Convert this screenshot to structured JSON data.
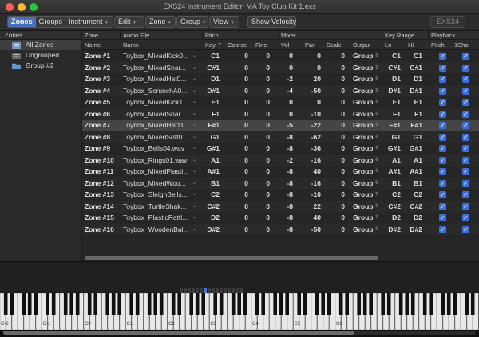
{
  "window": {
    "title": "EXS24 Instrument Editor: MA Toy Club Kit 1.exs"
  },
  "toolbar": {
    "view_toggle": [
      "Zones",
      "Groups"
    ],
    "menus": [
      "Instrument",
      "Edit",
      "Zone",
      "Group",
      "View"
    ],
    "show_velocity_label": "Show Velocity",
    "exs24_label": "EXS24"
  },
  "sidebar": {
    "header": "Zones",
    "items": [
      {
        "label": "All Zones",
        "icon": "all-zones-icon",
        "selected": true
      },
      {
        "label": "Ungrouped",
        "icon": "ungrouped-icon",
        "selected": false
      },
      {
        "label": "Group #2",
        "icon": "folder-icon",
        "selected": false
      }
    ]
  },
  "table": {
    "group_headers": [
      "Zone",
      "Audio File",
      "Pitch",
      "Mixer",
      "Key Range",
      "Playback"
    ],
    "columns": [
      "Name",
      "Name",
      "Key",
      "Coarse",
      "Fine",
      "Vol",
      "Pan",
      "Scale",
      "Output",
      "Lo",
      "Hi",
      "Pitch",
      "1Sho"
    ],
    "rows": [
      {
        "zone": "Zone #1",
        "file": "Toybox_MixedKick0...",
        "key": "C1",
        "coarse": "0",
        "fine": "0",
        "vol": "0",
        "pan": "0",
        "scale": "0",
        "output": "Group",
        "lo": "C1",
        "hi": "C1",
        "pitch": true,
        "oneshot": true
      },
      {
        "zone": "Zone #2",
        "file": "Toybox_MixedSnar...",
        "key": "C#1",
        "coarse": "0",
        "fine": "0",
        "vol": "0",
        "pan": "0",
        "scale": "0",
        "output": "Group",
        "lo": "C#1",
        "hi": "C#1",
        "pitch": true,
        "oneshot": true
      },
      {
        "zone": "Zone #3",
        "file": "Toybox_MixedHat0...",
        "key": "D1",
        "coarse": "0",
        "fine": "0",
        "vol": "-2",
        "pan": "20",
        "scale": "0",
        "output": "Group",
        "lo": "D1",
        "hi": "D1",
        "pitch": true,
        "oneshot": true
      },
      {
        "zone": "Zone #4",
        "file": "Toybox_ScrunchA0...",
        "key": "D#1",
        "coarse": "0",
        "fine": "0",
        "vol": "-4",
        "pan": "-50",
        "scale": "0",
        "output": "Group",
        "lo": "D#1",
        "hi": "D#1",
        "pitch": true,
        "oneshot": true
      },
      {
        "zone": "Zone #5",
        "file": "Toybox_MixedKick1...",
        "key": "E1",
        "coarse": "0",
        "fine": "0",
        "vol": "0",
        "pan": "0",
        "scale": "0",
        "output": "Group",
        "lo": "E1",
        "hi": "E1",
        "pitch": true,
        "oneshot": true
      },
      {
        "zone": "Zone #6",
        "file": "Toybox_MixedSnar...",
        "key": "F1",
        "coarse": "0",
        "fine": "0",
        "vol": "0",
        "pan": "-10",
        "scale": "0",
        "output": "Group",
        "lo": "F1",
        "hi": "F1",
        "pitch": true,
        "oneshot": true
      },
      {
        "zone": "Zone #7",
        "file": "Toybox_MixedHat11...",
        "key": "F#1",
        "coarse": "0",
        "fine": "0",
        "vol": "-5",
        "pan": "-22",
        "scale": "0",
        "output": "Group",
        "lo": "F#1",
        "hi": "F#1",
        "pitch": true,
        "oneshot": true,
        "selected": true
      },
      {
        "zone": "Zone #8",
        "file": "Toybox_MixedSoft0...",
        "key": "G1",
        "coarse": "0",
        "fine": "0",
        "vol": "-8",
        "pan": "-62",
        "scale": "0",
        "output": "Group",
        "lo": "G1",
        "hi": "G1",
        "pitch": true,
        "oneshot": true
      },
      {
        "zone": "Zone #9",
        "file": "Toybox_Bells04.wav",
        "key": "G#1",
        "coarse": "0",
        "fine": "0",
        "vol": "-8",
        "pan": "-36",
        "scale": "0",
        "output": "Group",
        "lo": "G#1",
        "hi": "G#1",
        "pitch": true,
        "oneshot": true
      },
      {
        "zone": "Zone #10",
        "file": "Toybox_Rings01.wav",
        "key": "A1",
        "coarse": "0",
        "fine": "0",
        "vol": "-2",
        "pan": "-16",
        "scale": "0",
        "output": "Group",
        "lo": "A1",
        "hi": "A1",
        "pitch": true,
        "oneshot": true
      },
      {
        "zone": "Zone #11",
        "file": "Toybox_MixedPlasti...",
        "key": "A#1",
        "coarse": "0",
        "fine": "0",
        "vol": "-8",
        "pan": "40",
        "scale": "0",
        "output": "Group",
        "lo": "A#1",
        "hi": "A#1",
        "pitch": true,
        "oneshot": true
      },
      {
        "zone": "Zone #12",
        "file": "Toybox_MixedWoo...",
        "key": "B1",
        "coarse": "0",
        "fine": "0",
        "vol": "-8",
        "pan": "-16",
        "scale": "0",
        "output": "Group",
        "lo": "B1",
        "hi": "B1",
        "pitch": true,
        "oneshot": true
      },
      {
        "zone": "Zone #13",
        "file": "Toybox_SleighBells...",
        "key": "C2",
        "coarse": "0",
        "fine": "0",
        "vol": "-8",
        "pan": "-10",
        "scale": "0",
        "output": "Group",
        "lo": "C2",
        "hi": "C2",
        "pitch": true,
        "oneshot": true
      },
      {
        "zone": "Zone #14",
        "file": "Toybox_TurtleShak...",
        "key": "C#2",
        "coarse": "0",
        "fine": "0",
        "vol": "-8",
        "pan": "22",
        "scale": "0",
        "output": "Group",
        "lo": "C#2",
        "hi": "C#2",
        "pitch": true,
        "oneshot": true
      },
      {
        "zone": "Zone #15",
        "file": "Toybox_PlasticRattl...",
        "key": "D2",
        "coarse": "0",
        "fine": "0",
        "vol": "-8",
        "pan": "40",
        "scale": "0",
        "output": "Group",
        "lo": "D2",
        "hi": "D2",
        "pitch": true,
        "oneshot": true
      },
      {
        "zone": "Zone #16",
        "file": "Toybox_WoodenBal...",
        "key": "D#2",
        "coarse": "0",
        "fine": "0",
        "vol": "-8",
        "pan": "-50",
        "scale": "0",
        "output": "Group",
        "lo": "D#2",
        "hi": "D#2",
        "pitch": true,
        "oneshot": true
      }
    ]
  },
  "keyboard": {
    "octave_labels": [
      "C-2",
      "C-1",
      "C0",
      "C1",
      "C2",
      "C3",
      "C4",
      "C5",
      "C6"
    ],
    "highlighted_zone": "F#1"
  },
  "colors": {
    "accent": "#4a6fbd",
    "checkbox": "#3e6fd8",
    "zone_highlight": "#4a78d8"
  }
}
